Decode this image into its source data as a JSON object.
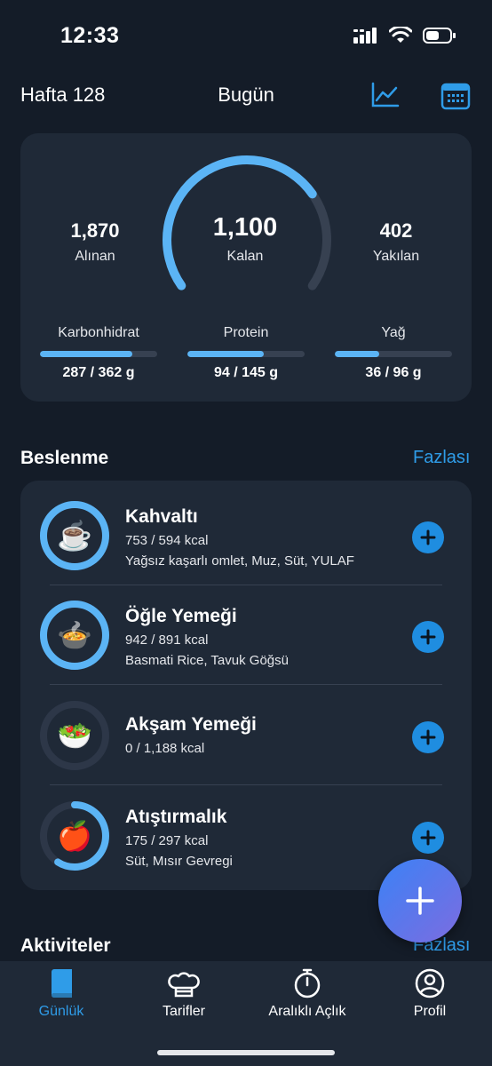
{
  "status": {
    "time": "12:33"
  },
  "header": {
    "week": "Hafta 128",
    "title": "Bugün"
  },
  "summary": {
    "eaten_value": "1,870",
    "eaten_label": "Alınan",
    "remaining_value": "1,100",
    "remaining_label": "Kalan",
    "burned_value": "402",
    "burned_label": "Yakılan",
    "macros": [
      {
        "label": "Karbonhidrat",
        "value": "287 / 362 g",
        "fraction": 0.79
      },
      {
        "label": "Protein",
        "value": "94 / 145 g",
        "fraction": 0.65
      },
      {
        "label": "Yağ",
        "value": "36 / 96 g",
        "fraction": 0.38
      }
    ]
  },
  "nutrition_section": {
    "title": "Beslenme",
    "more": "Fazlası"
  },
  "meals": [
    {
      "title": "Kahvaltı",
      "kcal": "753 / 594 kcal",
      "items": "Yağsız kaşarlı omlet, Muz, Süt, YULAF",
      "emoji": "☕",
      "progress": 1.0
    },
    {
      "title": "Öğle Yemeği",
      "kcal": "942 / 891 kcal",
      "items": "Basmati Rice, Tavuk Göğsü",
      "emoji": "🍲",
      "progress": 1.0
    },
    {
      "title": "Akşam Yemeği",
      "kcal": "0 / 1,188 kcal",
      "items": "",
      "emoji": "🥗",
      "progress": 0.0
    },
    {
      "title": "Atıştırmalık",
      "kcal": "175 / 297 kcal",
      "items": "Süt, Mısır Gevregi",
      "emoji": "🍎",
      "progress": 0.59
    }
  ],
  "activities_section": {
    "title": "Aktiviteler",
    "more": "Fazlası"
  },
  "tabs": [
    {
      "label": "Günlük",
      "icon": "book-icon",
      "active": true
    },
    {
      "label": "Tarifler",
      "icon": "chef-hat-icon",
      "active": false
    },
    {
      "label": "Aralıklı Açlık",
      "icon": "stopwatch-icon",
      "active": false
    },
    {
      "label": "Profil",
      "icon": "profile-icon",
      "active": false
    }
  ],
  "colors": {
    "accent": "#2f9ce8",
    "ring": "#5bb4f5",
    "card": "#1f2937",
    "background": "#141c28"
  }
}
